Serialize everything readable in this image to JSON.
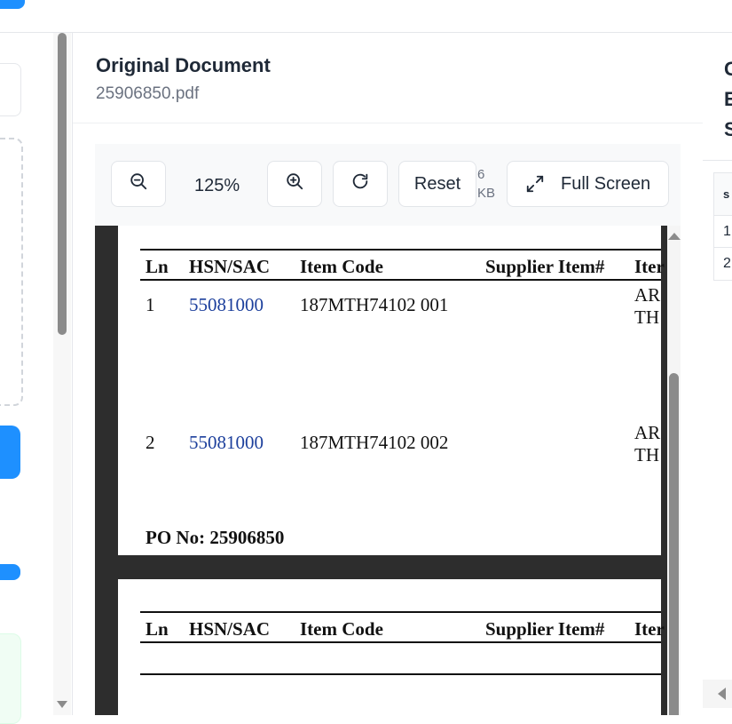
{
  "center": {
    "title": "Original Document",
    "filename": "25906850.pdf"
  },
  "toolbar": {
    "zoom_out_icon": "zoom-out-icon",
    "zoom_level": "125%",
    "zoom_in_icon": "zoom-in-icon",
    "rotate_icon": "rotate-icon",
    "reset_label": "Reset",
    "file_size": "6 KB",
    "fullscreen_label": "Full Screen"
  },
  "pdf": {
    "headers": [
      "Ln",
      "HSN/SAC",
      "Item Code",
      "Supplier Item#",
      "Iter"
    ],
    "rows": [
      {
        "ln": "1",
        "hsn": "55081000",
        "item_code": "187MTH74102 001",
        "desc1": "AR",
        "desc2": "TH"
      },
      {
        "ln": "2",
        "hsn": "55081000",
        "item_code": "187MTH74102 002",
        "desc1": "AR",
        "desc2": "TH"
      }
    ],
    "po_label": "PO No: 25906850"
  },
  "right_panel": {
    "lines": [
      "G",
      "E",
      "S"
    ],
    "table_head": "s",
    "rows": [
      "1",
      "2"
    ]
  },
  "colors": {
    "accent": "#1e90ff",
    "hsn_link": "#1c3f9c",
    "pdf_background": "#2d2d2d"
  }
}
